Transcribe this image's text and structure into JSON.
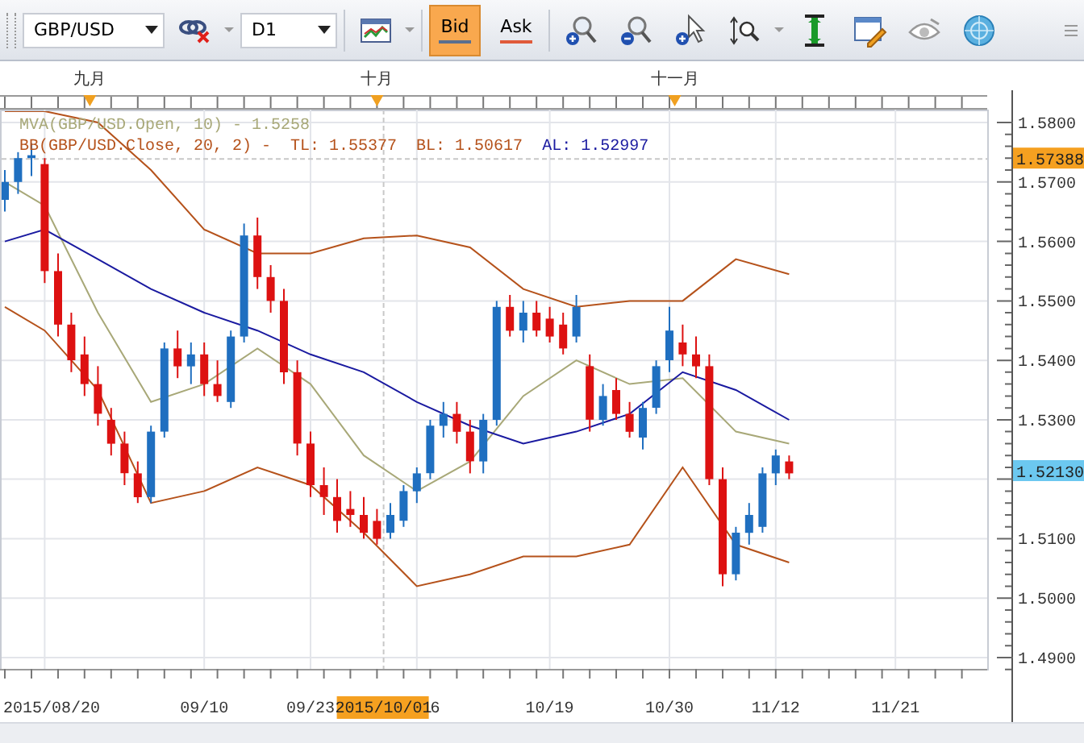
{
  "toolbar": {
    "symbol": "GBP/USD",
    "timeframe": "D1",
    "price_buttons": [
      {
        "label": "Bid",
        "selected": true,
        "color": "#5a6f8f"
      },
      {
        "label": "Ask",
        "selected": false,
        "color": "#e05a3a"
      }
    ]
  },
  "chart": {
    "months": [
      {
        "label": "九月"
      },
      {
        "label": "十月"
      },
      {
        "label": "十一月"
      }
    ],
    "legend": [
      {
        "parts": [
          {
            "text": "MVA(GBP/USD.Open, 10) - 1.5258",
            "color": "#a8a878"
          }
        ]
      },
      {
        "parts": [
          {
            "text": "BB(GBP/USD.Close, 20, 2) -",
            "color": "#b5521b"
          },
          {
            "text": "TL: 1.55377",
            "color": "#b5521b"
          },
          {
            "text": "BL: 1.50617",
            "color": "#b5521b"
          },
          {
            "text": "AL: 1.52997",
            "color": "#1a1aa0"
          }
        ]
      }
    ],
    "price_labels": [
      "1.5800",
      "1.5700",
      "1.5600",
      "1.5500",
      "1.5400",
      "1.5300",
      "1.5100",
      "1.5000",
      "1.4900"
    ],
    "date_labels": [
      "2015/08/20",
      "09/10",
      "09/23",
      "6",
      "10/19",
      "10/30",
      "11/12",
      "11/21"
    ],
    "crosshair": {
      "date": "2015/10/01",
      "price": "1.57388"
    },
    "last_price": "1.52130"
  }
}
